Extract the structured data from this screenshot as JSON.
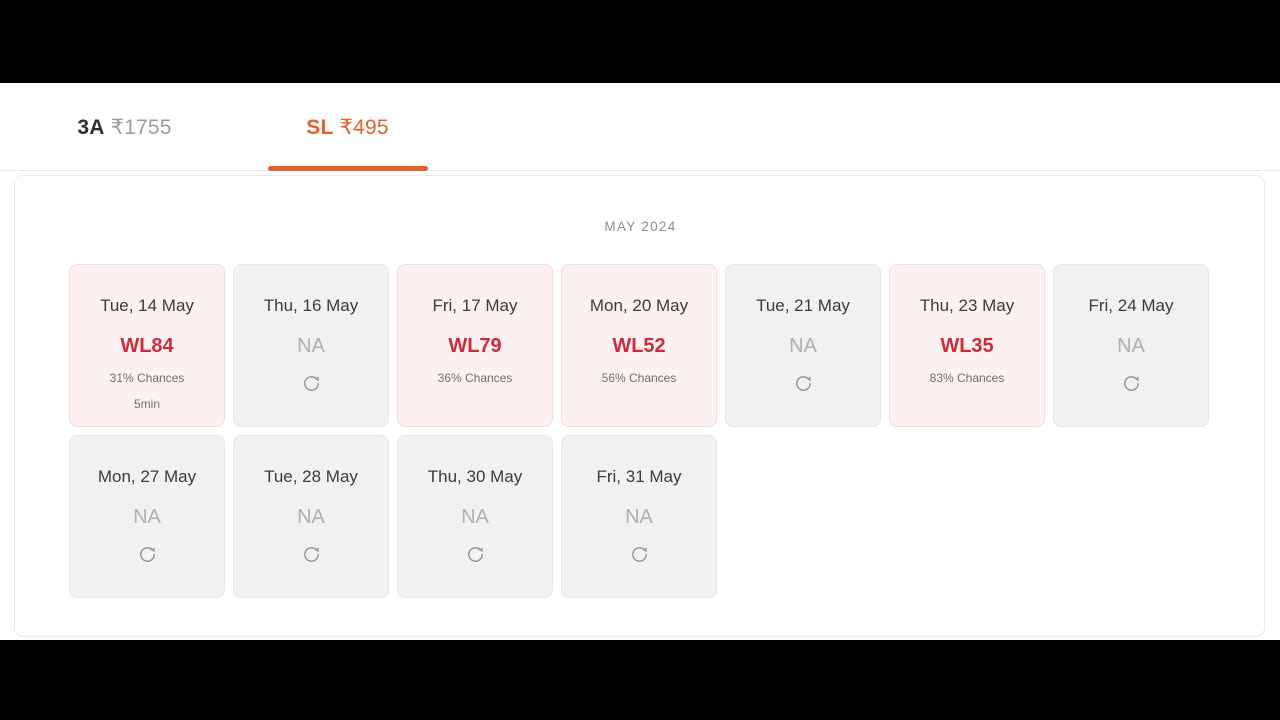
{
  "tabs": [
    {
      "code": "3A",
      "price": "₹1755",
      "active": false,
      "name": "tab-3a"
    },
    {
      "code": "SL",
      "price": "₹495",
      "active": true,
      "name": "tab-sl"
    }
  ],
  "panel": {
    "month_label": "MAY 2024"
  },
  "colors": {
    "accent": "#e2622a",
    "available_text": "#cc2b3c",
    "available_bg": "#fdf0f1",
    "na_bg": "#f1f1f1",
    "na_text": "#b0b0b0"
  },
  "icons": {
    "refresh": "refresh-icon"
  },
  "days": [
    {
      "date": "Tue, 14 May",
      "status": "WL84",
      "chances": "31% Chances",
      "time": "5min",
      "available": true
    },
    {
      "date": "Thu, 16 May",
      "status": "NA",
      "chances": "",
      "time": "",
      "available": false
    },
    {
      "date": "Fri, 17 May",
      "status": "WL79",
      "chances": "36% Chances",
      "time": "",
      "available": true
    },
    {
      "date": "Mon, 20 May",
      "status": "WL52",
      "chances": "56% Chances",
      "time": "",
      "available": true
    },
    {
      "date": "Tue, 21 May",
      "status": "NA",
      "chances": "",
      "time": "",
      "available": false
    },
    {
      "date": "Thu, 23 May",
      "status": "WL35",
      "chances": "83% Chances",
      "time": "",
      "available": true
    },
    {
      "date": "Fri, 24 May",
      "status": "NA",
      "chances": "",
      "time": "",
      "available": false
    },
    {
      "date": "Mon, 27 May",
      "status": "NA",
      "chances": "",
      "time": "",
      "available": false
    },
    {
      "date": "Tue, 28 May",
      "status": "NA",
      "chances": "",
      "time": "",
      "available": false
    },
    {
      "date": "Thu, 30 May",
      "status": "NA",
      "chances": "",
      "time": "",
      "available": false
    },
    {
      "date": "Fri, 31 May",
      "status": "NA",
      "chances": "",
      "time": "",
      "available": false
    }
  ]
}
